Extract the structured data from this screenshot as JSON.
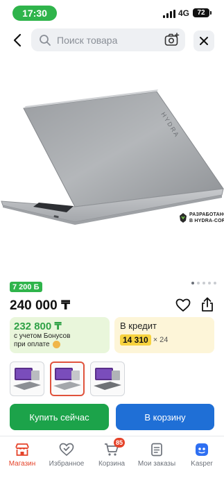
{
  "status_bar": {
    "time": "17:30",
    "network": "4G",
    "battery": "72"
  },
  "search": {
    "placeholder": "Поиск товара"
  },
  "product": {
    "developer_badge": "РАЗРАБОТАНО В HYDRA-CORP",
    "bonus_badge": "7 200 Б",
    "price": "240 000 ₸",
    "gallery": {
      "total": 5,
      "active_index": 1
    },
    "bonus_card": {
      "amount": "232 800 ₸",
      "note_line1": "с учетом Бонусов",
      "note_line2": "при оплате"
    },
    "credit_card": {
      "title": "В кредит",
      "monthly": "14 310",
      "months": "× 24"
    },
    "thumbnails_selected": 1
  },
  "actions": {
    "buy_now": "Купить сейчас",
    "add_to_cart": "В корзину"
  },
  "tab_bar": {
    "items": [
      {
        "label": "Магазин",
        "icon": "shop-icon",
        "active": true
      },
      {
        "label": "Избранное",
        "icon": "heart-check-icon",
        "active": false
      },
      {
        "label": "Корзина",
        "icon": "cart-icon",
        "active": false
      },
      {
        "label": "Мои заказы",
        "icon": "orders-icon",
        "active": false
      },
      {
        "label": "Kasper",
        "icon": "kasper-icon",
        "active": false
      }
    ],
    "cart_badge": "85"
  },
  "colors": {
    "accent_green": "#2fb44b",
    "buy_button": "#1ca34a",
    "cart_button": "#1f6fd6",
    "active_tab": "#e5432a",
    "credit_highlight": "#f7d33f"
  }
}
